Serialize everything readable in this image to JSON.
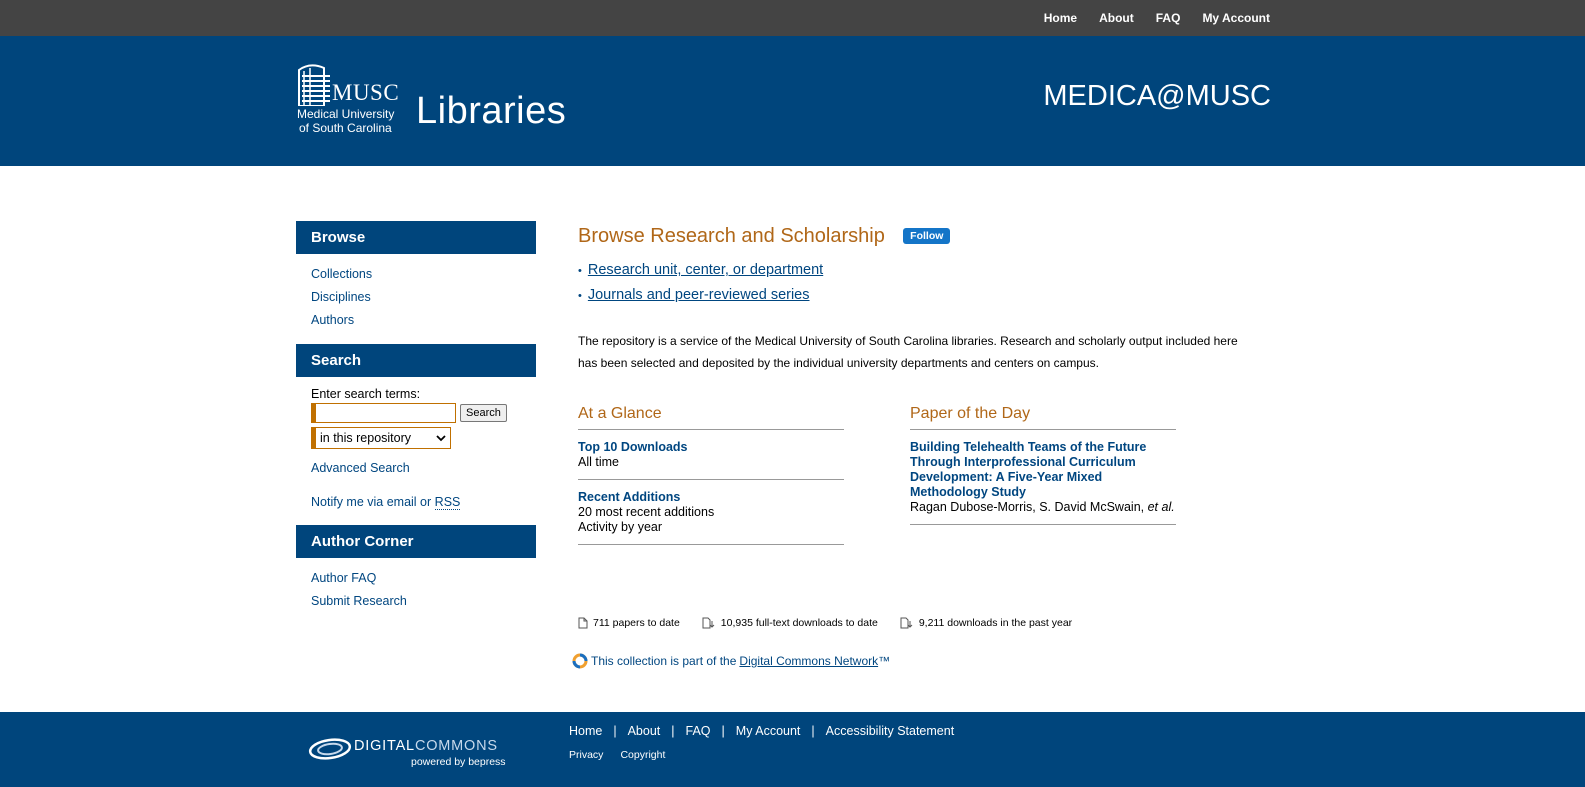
{
  "topnav": {
    "items": [
      "Home",
      "About",
      "FAQ",
      "My Account"
    ]
  },
  "header": {
    "logo_musc": "MUSC",
    "logo_univ_line1": "Medical University",
    "logo_univ_line2": "of South Carolina",
    "logo_libraries": "Libraries",
    "site_name": "MEDICA@MUSC"
  },
  "sidebar": {
    "browse_heading": "Browse",
    "browse_items": [
      "Collections",
      "Disciplines",
      "Authors"
    ],
    "search_heading": "Search",
    "search_label": "Enter search terms:",
    "search_value": "",
    "search_button": "Search",
    "scope_selected": "in this repository",
    "advanced_search": "Advanced Search",
    "notify_prefix": "Notify me via email or",
    "notify_rss": "RSS",
    "author_heading": "Author Corner",
    "author_items": [
      "Author FAQ",
      "Submit Research"
    ]
  },
  "main": {
    "title": "Browse Research and Scholarship",
    "follow": "Follow",
    "browse_links": [
      "Research unit, center, or department",
      "Journals and peer-reviewed series"
    ],
    "intro": "The repository is a service of the Medical University of South Carolina libraries. Research and scholarly output included here has been selected and deposited by the individual university departments and centers on campus.",
    "glance": {
      "heading": "At a Glance",
      "top10_title": "Top 10 Downloads",
      "top10_sub": "All time",
      "recent_title": "Recent Additions",
      "recent_sub1": "20 most recent additions",
      "recent_sub2": "Activity by year"
    },
    "paper": {
      "heading": "Paper of the Day",
      "title": "Building Telehealth Teams of the Future Through Interprofessional Curriculum Development: A Five-Year Mixed Methodology Study",
      "authors": "Ragan Dubose-Morris, S. David McSwain,",
      "etal": "et al."
    },
    "stats": {
      "papers": "711 papers to date",
      "downloads": "10,935 full-text downloads to date",
      "past_year": "9,211 downloads in the past year"
    },
    "dcn_prefix": "This collection is part of the",
    "dcn_link": "Digital Commons Network",
    "dcn_tm": "™"
  },
  "footer": {
    "dc_digital": "DIGITAL",
    "dc_commons": "COMMONS",
    "dc_powered": "powered by bepress",
    "links": [
      "Home",
      "About",
      "FAQ",
      "My Account",
      "Accessibility Statement"
    ],
    "separator": "|",
    "links2": [
      "Privacy",
      "Copyright"
    ]
  },
  "colors": {
    "topnav_bg": "#444444",
    "brand_blue": "#00457c",
    "heading_orange": "#b06718",
    "link_blue": "#004680",
    "follow_blue": "#1475c8"
  }
}
